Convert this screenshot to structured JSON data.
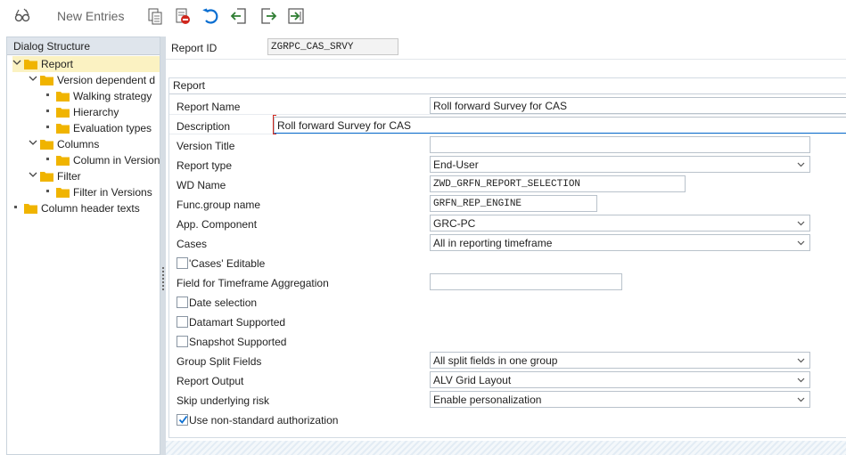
{
  "toolbar": {
    "new_entries_label": "New Entries",
    "icons": [
      "glasses-change-icon",
      "copy-icon",
      "delete-icon",
      "undo-icon",
      "export-icon",
      "import-icon",
      "select-all-icon"
    ]
  },
  "dialog_structure": {
    "header": "Dialog Structure",
    "nodes": [
      {
        "label": "Report",
        "level": 0,
        "expanded": true,
        "selected": true
      },
      {
        "label": "Version dependent d",
        "level": 1,
        "expanded": true
      },
      {
        "label": "Walking strategy",
        "level": 2,
        "leaf": true
      },
      {
        "label": "Hierarchy",
        "level": 2,
        "leaf": true
      },
      {
        "label": "Evaluation types",
        "level": 2,
        "leaf": true
      },
      {
        "label": "Columns",
        "level": 1,
        "expanded": true
      },
      {
        "label": "Column in Versions",
        "level": 2,
        "leaf": true
      },
      {
        "label": "Filter",
        "level": 1,
        "expanded": true
      },
      {
        "label": "Filter in Versions",
        "level": 2,
        "leaf": true
      },
      {
        "label": "Column header texts",
        "level": 0,
        "leaf": true
      }
    ]
  },
  "report_id": {
    "label": "Report ID",
    "value": "ZGRPC_CAS_SRVY"
  },
  "group": {
    "title": "Report"
  },
  "fields": {
    "report_name": {
      "label": "Report Name",
      "value": "Roll forward Survey for CAS"
    },
    "description": {
      "label": "Description",
      "value": "Roll forward Survey for CAS"
    },
    "version_title": {
      "label": "Version Title",
      "value": ""
    },
    "report_type": {
      "label": "Report type",
      "value": "End-User"
    },
    "wd_name": {
      "label": "WD Name",
      "value": "ZWD_GRFN_REPORT_SELECTION"
    },
    "func_group": {
      "label": "Func.group name",
      "value": "GRFN_REP_ENGINE"
    },
    "app_component": {
      "label": "App. Component",
      "value": "GRC-PC"
    },
    "cases": {
      "label": "Cases",
      "value": "All in reporting timeframe"
    },
    "cases_editable": {
      "label": "'Cases' Editable",
      "checked": false
    },
    "timeframe_field": {
      "label": "Field for Timeframe Aggregation",
      "value": ""
    },
    "date_selection": {
      "label": "Date selection",
      "checked": false
    },
    "datamart": {
      "label": "Datamart Supported",
      "checked": false
    },
    "snapshot": {
      "label": "Snapshot Supported",
      "checked": false
    },
    "group_split": {
      "label": "Group Split Fields",
      "value": "All split fields in one group"
    },
    "report_output": {
      "label": "Report Output",
      "value": "ALV Grid Layout"
    },
    "skip_risk": {
      "label": "Skip underlying risk",
      "value": "Enable personalization"
    },
    "non_std_auth": {
      "label": "Use non-standard authorization",
      "checked": true
    }
  },
  "colors": {
    "accent": "#0a6ed1",
    "folder": "#f0b400",
    "selected_bg": "#fbf2c2"
  }
}
